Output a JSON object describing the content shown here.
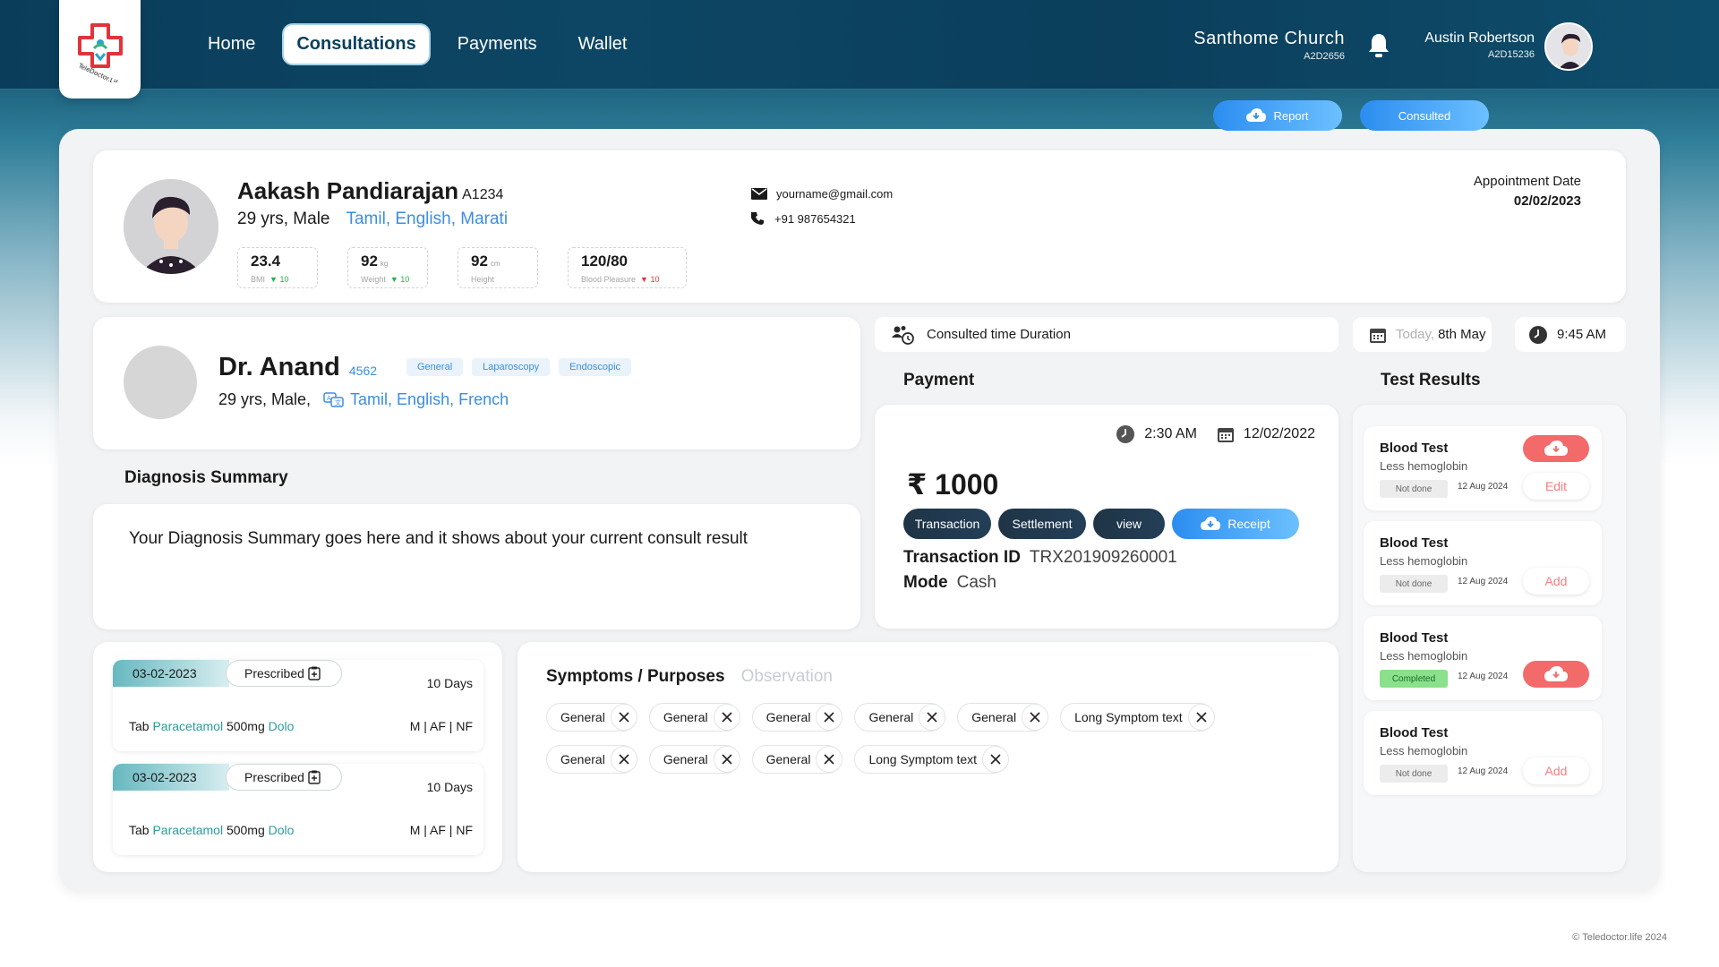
{
  "nav": {
    "logo_text": "TeleDoctor.Life",
    "items": [
      {
        "label": "Home",
        "active": false
      },
      {
        "label": "Consultations",
        "active": true
      },
      {
        "label": "Payments",
        "active": false
      },
      {
        "label": "Wallet",
        "active": false
      }
    ]
  },
  "header": {
    "location_name": "Santhome Church",
    "location_code": "A2D2656",
    "user_name": "Austin Robertson",
    "user_code": "A2D15236",
    "icons": [
      "bell-icon",
      "avatar"
    ]
  },
  "patient": {
    "name": "Aakash Pandiarajan",
    "id": "A1234",
    "age_gender": "29 yrs, Male",
    "languages": "Tamil, English, Marati",
    "email": "yourname@gmail.com",
    "phone": "+91 987654321",
    "vitals": [
      {
        "value": "23.4",
        "unit": "",
        "label": "BMI",
        "delta": "10",
        "direction": "down",
        "delta_color": "#23b04c"
      },
      {
        "value": "92",
        "unit": "kg",
        "label": "Weight",
        "delta": "10",
        "direction": "down",
        "delta_color": "#23b04c"
      },
      {
        "value": "92",
        "unit": "cm",
        "label": "Height",
        "delta": "",
        "direction": "",
        "delta_color": ""
      },
      {
        "value": "120/80",
        "unit": "",
        "label": "Blood Pleasure",
        "delta": "10",
        "direction": "down",
        "delta_color": "#e23535"
      }
    ],
    "appointment_label": "Appointment Date",
    "appointment_date": "02/02/2023",
    "report_label": "Report",
    "consulted_label": "Consulted"
  },
  "doctor": {
    "name": "Dr. Anand",
    "id": "4562",
    "tags": [
      "General",
      "Laparoscopy",
      "Endoscopic"
    ],
    "age_gender": "29 yrs, Male,",
    "languages": "Tamil, English, French"
  },
  "diagnosis": {
    "title": "Diagnosis Summary",
    "text": "Your Diagnosis Summary goes here and it shows about your current consult result"
  },
  "consult": {
    "duration_label": "Consulted time Duration",
    "today_label": "Today,",
    "today_date": "8th May",
    "time": "9:45 AM"
  },
  "payment": {
    "title": "Payment",
    "time": "2:30 AM",
    "date": "12/02/2022",
    "amount": "₹ 1000",
    "buttons": [
      "Transaction",
      "Settlement",
      "view"
    ],
    "receipt_label": "Receipt",
    "tx_id_label": "Transaction ID",
    "tx_id": "TRX201909260001",
    "mode_label": "Mode",
    "mode": "Cash"
  },
  "tests": {
    "title": "Test Results",
    "items": [
      {
        "title": "Blood Test",
        "sub": "Less hemoglobin",
        "status": "Not done",
        "date": "12 Aug 2024",
        "action": "Edit",
        "has_download": true
      },
      {
        "title": "Blood Test",
        "sub": "Less hemoglobin",
        "status": "Not done",
        "date": "12 Aug 2024",
        "action": "Add",
        "has_download": false
      },
      {
        "title": "Blood Test",
        "sub": "Less hemoglobin",
        "status": "Completed",
        "date": "12 Aug 2024",
        "action": "",
        "has_download": true
      },
      {
        "title": "Blood Test",
        "sub": "Less hemoglobin",
        "status": "Not done",
        "date": "12 Aug 2024",
        "action": "Add",
        "has_download": false
      }
    ]
  },
  "prescriptions": [
    {
      "date": "03-02-2023",
      "status": "Prescribed",
      "days": "10 Days",
      "med_prefix": "Tab ",
      "med_name": "Paracetamol",
      "dose": " 500mg ",
      "brand": "Dolo",
      "freq": "M | AF | NF"
    },
    {
      "date": "03-02-2023",
      "status": "Prescribed",
      "days": "10 Days",
      "med_prefix": "Tab ",
      "med_name": "Paracetamol",
      "dose": " 500mg ",
      "brand": "Dolo",
      "freq": "M | AF | NF"
    }
  ],
  "symptoms": {
    "tab_active": "Symptoms / Purposes",
    "tab_inactive": "Observation",
    "row1": [
      "General",
      "General",
      "General",
      "General",
      "General",
      "Long Symptom text"
    ],
    "row2": [
      "General",
      "General",
      "General",
      "Long Symptom text"
    ]
  },
  "footer": "© Teledoctor.life 2024"
}
